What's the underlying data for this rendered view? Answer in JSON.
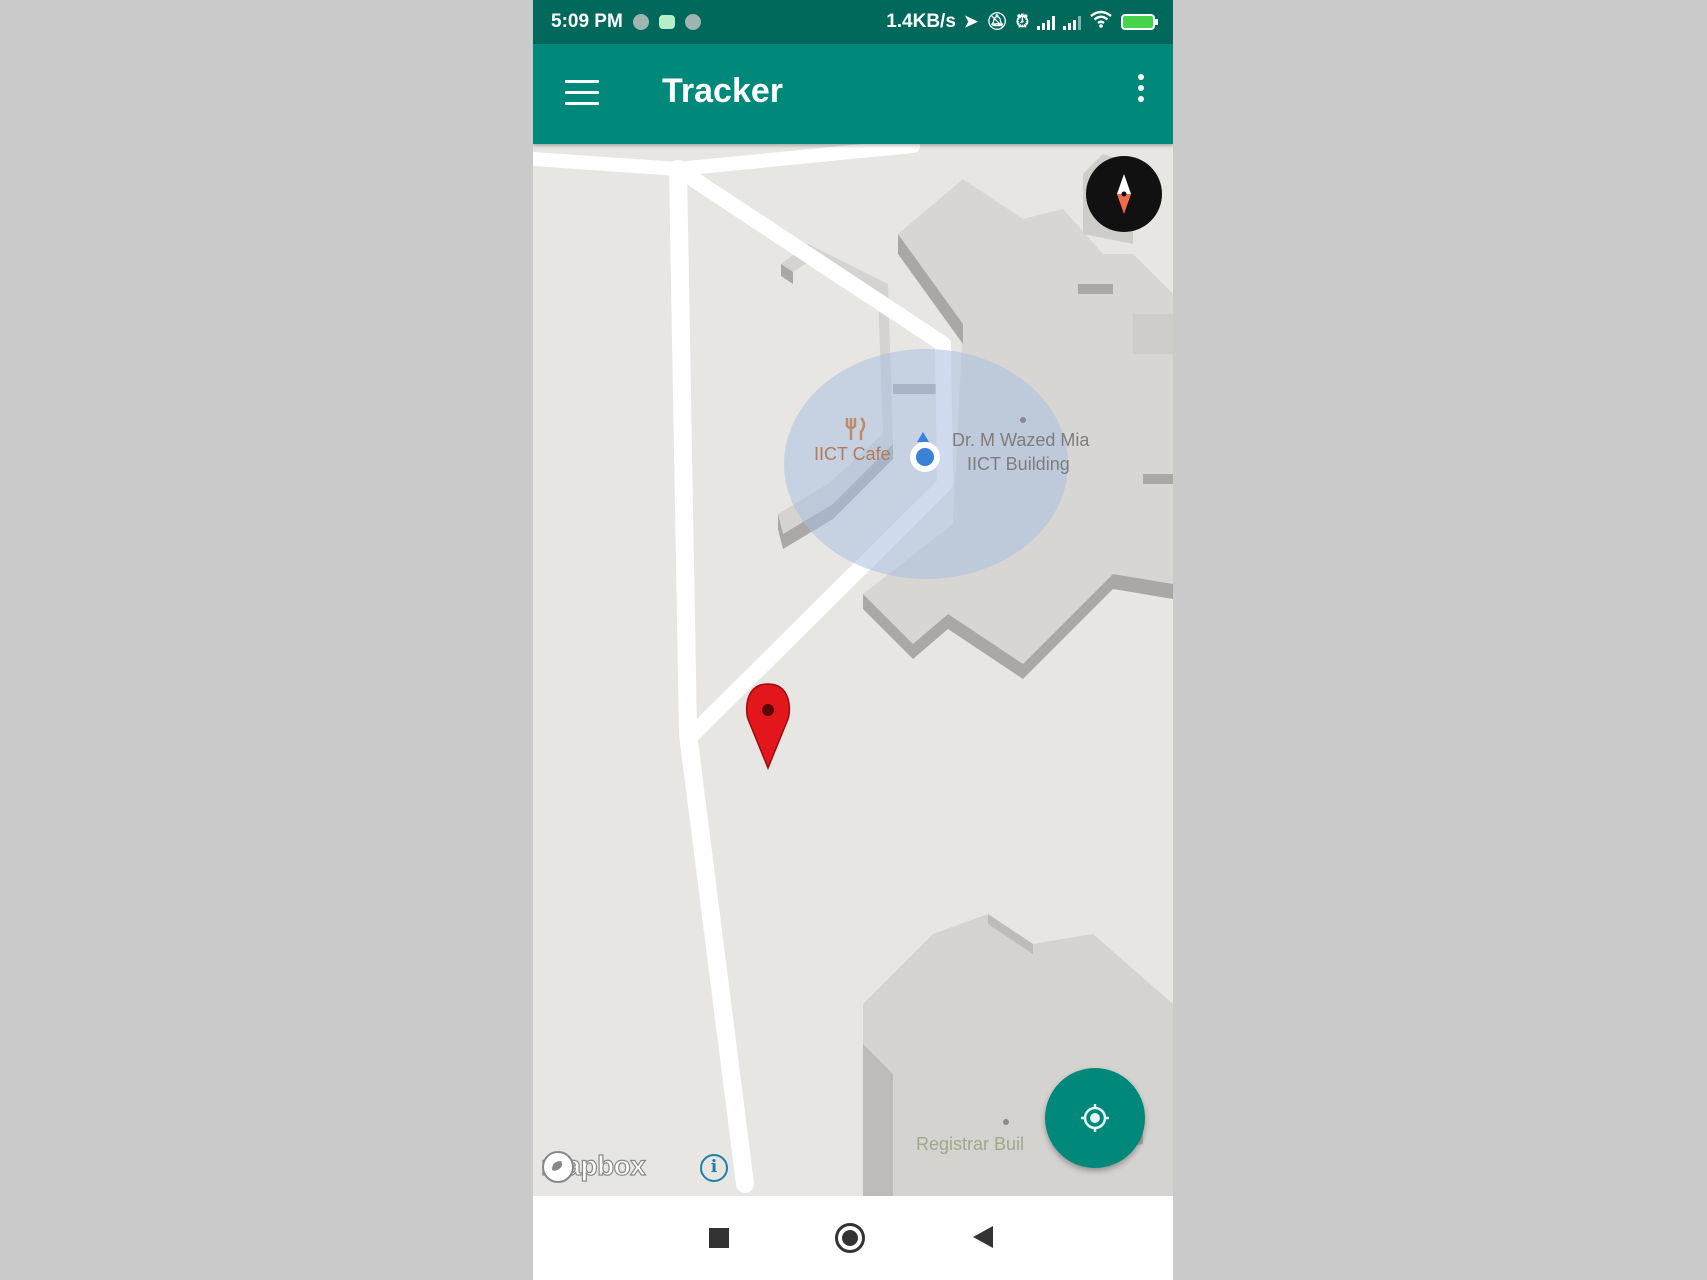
{
  "status_bar": {
    "time": "5:09 PM",
    "network_speed": "1.4KB/s",
    "icons": [
      "notification-dot-icon",
      "android-icon",
      "notification-dot-icon",
      "location-arrow-icon",
      "notifications-off-icon",
      "alarm-icon",
      "signal-icon",
      "signal-icon",
      "wifi-icon",
      "battery-charging-icon"
    ]
  },
  "app_bar": {
    "title": "Tracker",
    "menu_icon": "hamburger-menu-icon",
    "overflow_icon": "more-vert-icon"
  },
  "map": {
    "labels": {
      "cafe": "IICT Cafe",
      "building_line1": "Dr. M Wazed Mia",
      "building_line2": "IICT Building",
      "registrar": "Registrar Buil"
    },
    "attribution": "mapbox",
    "info_icon": "info-icon",
    "compass_icon": "compass-icon",
    "locate_icon": "my-location-icon",
    "marker_icon": "red-map-pin-icon",
    "colors": {
      "accent": "#00897b",
      "status_bar": "#00695c",
      "marker": "#e3161c",
      "accuracy_circle": "#a9bfe0",
      "user_location": "#3b82d6"
    }
  },
  "nav_bar": {
    "icons": [
      "recents-square-icon",
      "home-circle-icon",
      "back-triangle-icon"
    ]
  }
}
